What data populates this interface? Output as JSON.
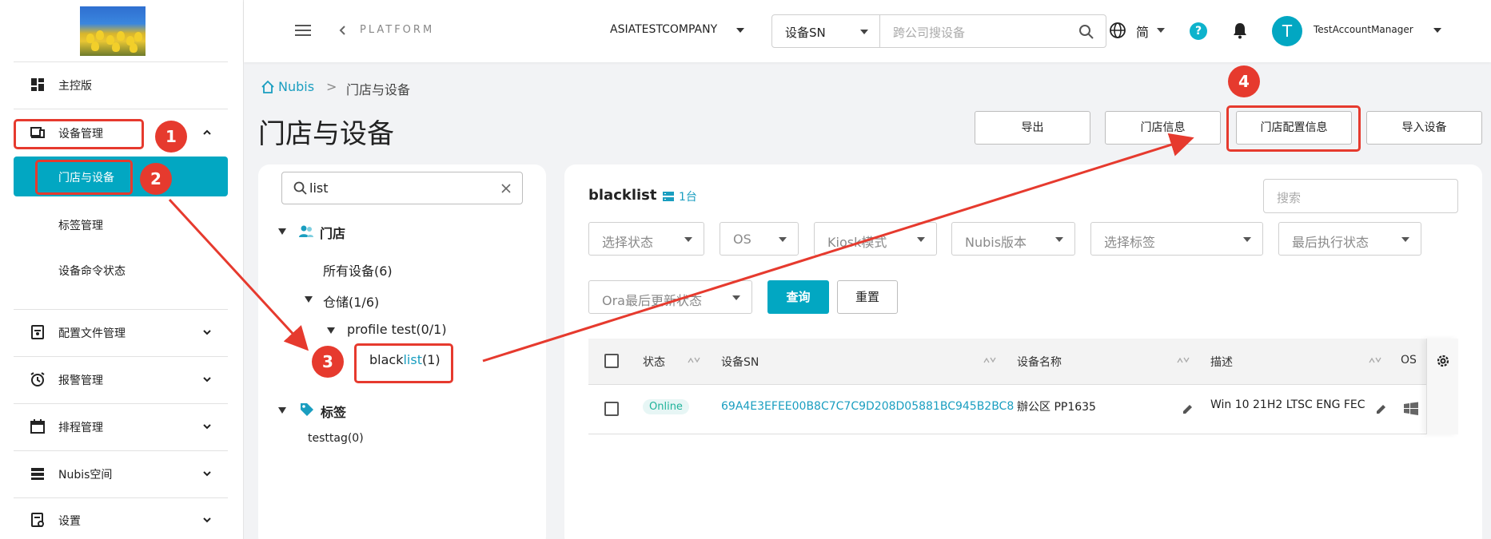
{
  "sidebar": {
    "items": [
      {
        "label": "主控版",
        "icon": "dashboard-icon"
      },
      {
        "label": "设备管理",
        "icon": "devices-icon"
      },
      {
        "label": "配置文件管理",
        "icon": "profile-icon"
      },
      {
        "label": "报警管理",
        "icon": "alarm-icon"
      },
      {
        "label": "排程管理",
        "icon": "calendar-icon"
      },
      {
        "label": "Nubis空间",
        "icon": "storage-icon"
      },
      {
        "label": "设置",
        "icon": "settings-icon"
      }
    ],
    "sub_items": [
      {
        "label": "门店与设备"
      },
      {
        "label": "标签管理"
      },
      {
        "label": "设备命令状态"
      }
    ]
  },
  "topbar": {
    "platform": "PLATFORM",
    "company": "ASIATESTCOMPANY",
    "search_type": "设备SN",
    "search_placeholder": "跨公司搜设备",
    "language": "简",
    "help": "?",
    "avatar_letter": "T",
    "username": "TestAccountManager"
  },
  "breadcrumb": {
    "home": "Nubis",
    "separator": ">",
    "current": "门店与设备"
  },
  "page_title": "门店与设备",
  "actions": {
    "export": "导出",
    "store_info": "门店信息",
    "store_config": "门店配置信息",
    "import": "导入设备"
  },
  "tree": {
    "search_value": "list",
    "stores_label": "门店",
    "all_devices": "所有设备(6)",
    "warehouse": "仓储(1/6)",
    "profile_test": "profile test(0/1)",
    "blacklist_prefix": "black",
    "blacklist_match": "list",
    "blacklist_suffix": "(1)",
    "tags_label": "标签",
    "testtag": "testtag(0)"
  },
  "main": {
    "group_title": "blacklist",
    "count": "1台",
    "search_placeholder": "搜索",
    "filters": [
      "选择状态",
      "OS",
      "Kiosk模式",
      "Nubis版本",
      "选择标签",
      "最后执行状态",
      "Ora最后更新状态"
    ],
    "query": "查询",
    "reset": "重置"
  },
  "table": {
    "headers": [
      "状态",
      "设备SN",
      "设备名称",
      "描述",
      "OS"
    ],
    "rows": [
      {
        "status": "Online",
        "sn": "69A4E3EFEE00B8C7C7C9D208D05881BC945B2BC8",
        "name": "辦公区 PP1635",
        "description": "Win 10 21H2 LTSC ENG FEC"
      }
    ]
  },
  "annotations": {
    "steps": [
      "1",
      "2",
      "3",
      "4"
    ],
    "color": "#e63a2e"
  },
  "colors": {
    "accent": "#02a7c2",
    "link": "#1a9ec0",
    "online": "#1fb39a"
  }
}
